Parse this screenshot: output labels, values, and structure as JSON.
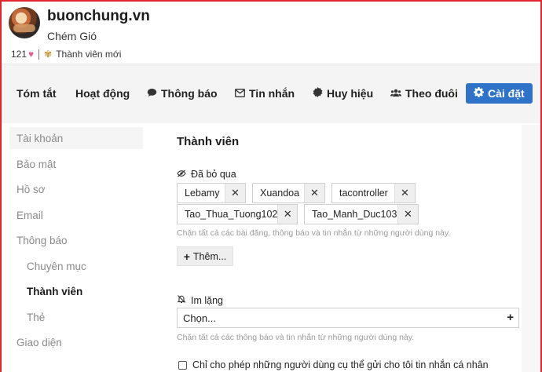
{
  "profile": {
    "site_name": "buonchung.vn",
    "tagline": "Chém Gió",
    "likes": "121",
    "rank": "Thành viên mới"
  },
  "tabs": [
    {
      "label": "Tóm tắt"
    },
    {
      "label": "Hoạt động"
    },
    {
      "label": "Thông báo",
      "icon": "speech-bubble-icon"
    },
    {
      "label": "Tin nhắn",
      "icon": "envelope-icon"
    },
    {
      "label": "Huy hiệu",
      "icon": "badge-icon"
    },
    {
      "label": "Theo đuôi",
      "icon": "users-icon"
    },
    {
      "label": "Cài đặt",
      "icon": "gear-icon",
      "active": true
    }
  ],
  "sidebar": {
    "items": [
      {
        "label": "Tài khoản"
      },
      {
        "label": "Bảo mật"
      },
      {
        "label": "Hồ sơ"
      },
      {
        "label": "Email"
      },
      {
        "label": "Thông báo"
      },
      {
        "label": "Chuyên mục"
      },
      {
        "label": "Thành viên"
      },
      {
        "label": "Thẻ"
      },
      {
        "label": "Giao diện"
      }
    ]
  },
  "main": {
    "title": "Thành viên",
    "ignored": {
      "label": "Đã bỏ qua",
      "users": [
        "Lebamy",
        "Xuandoa",
        "tacontroller",
        "Tao_Thua_Tuong102",
        "Tao_Manh_Duc103"
      ],
      "remove_symbol": "✕",
      "hint": "Chặn tất cả các bài đăng, thông báo và tin nhắn từ những người dùng này.",
      "add_label": "Thêm..."
    },
    "muted": {
      "label": "Im lặng",
      "select_placeholder": "Chọn...",
      "hint": "Chặn tất cả các thông báo và tin nhắn từ những người dùng này."
    },
    "allow_pm_label": "Chỉ cho phép những người dùng cụ thể gửi cho tôi tin nhắn cá nhân"
  },
  "colors": {
    "accent": "#2f73c8",
    "border": "#e3262e",
    "heart": "#e35d8a"
  }
}
